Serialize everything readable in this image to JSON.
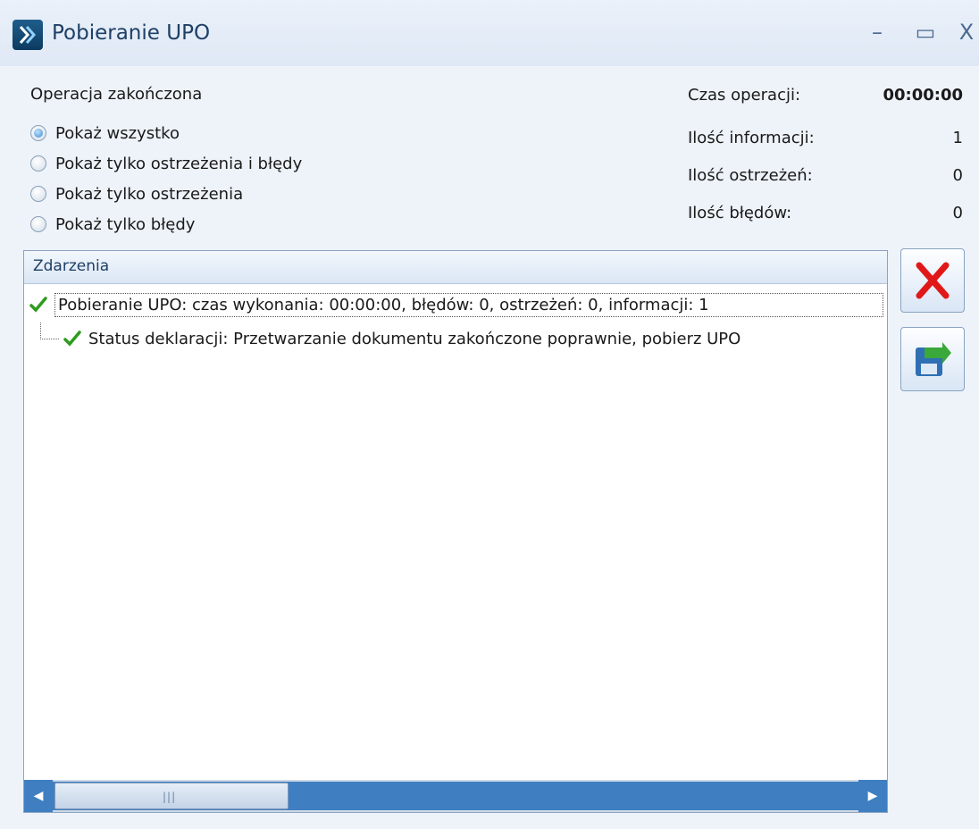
{
  "window": {
    "title": "Pobieranie UPO",
    "controls": {
      "minimize": "–",
      "maximize": "▭",
      "close": "X"
    }
  },
  "status": "Operacja zakończona",
  "filters": [
    {
      "label": "Pokaż wszystko",
      "checked": true
    },
    {
      "label": "Pokaż tylko ostrzeżenia i błędy",
      "checked": false
    },
    {
      "label": "Pokaż tylko ostrzeżenia",
      "checked": false
    },
    {
      "label": "Pokaż tylko błędy",
      "checked": false
    }
  ],
  "stats": {
    "time_label": "Czas operacji:",
    "time_value": "00:00:00",
    "info_label": "Ilość informacji:",
    "info_value": "1",
    "warnings_label": "Ilość ostrzeżeń:",
    "warnings_value": "0",
    "errors_label": "Ilość błędów:",
    "errors_value": "0"
  },
  "events": {
    "header": "Zdarzenia",
    "rows": [
      {
        "text": "Pobieranie UPO: czas wykonania: 00:00:00, błędów: 0, ostrzeżeń: 0, informacji: 1",
        "icon": "check-icon"
      },
      {
        "text": "Status deklaracji: Przetwarzanie dokumentu zakończone poprawnie, pobierz UPO",
        "icon": "check-icon"
      }
    ]
  },
  "buttons": {
    "cancel_icon": "red-x-icon",
    "save_icon": "save-floppy-icon"
  },
  "colors": {
    "title": "#1e3f66",
    "check": "#2e9b1e",
    "cancel": "#e01818",
    "scrollbar": "#3f7fc1"
  }
}
